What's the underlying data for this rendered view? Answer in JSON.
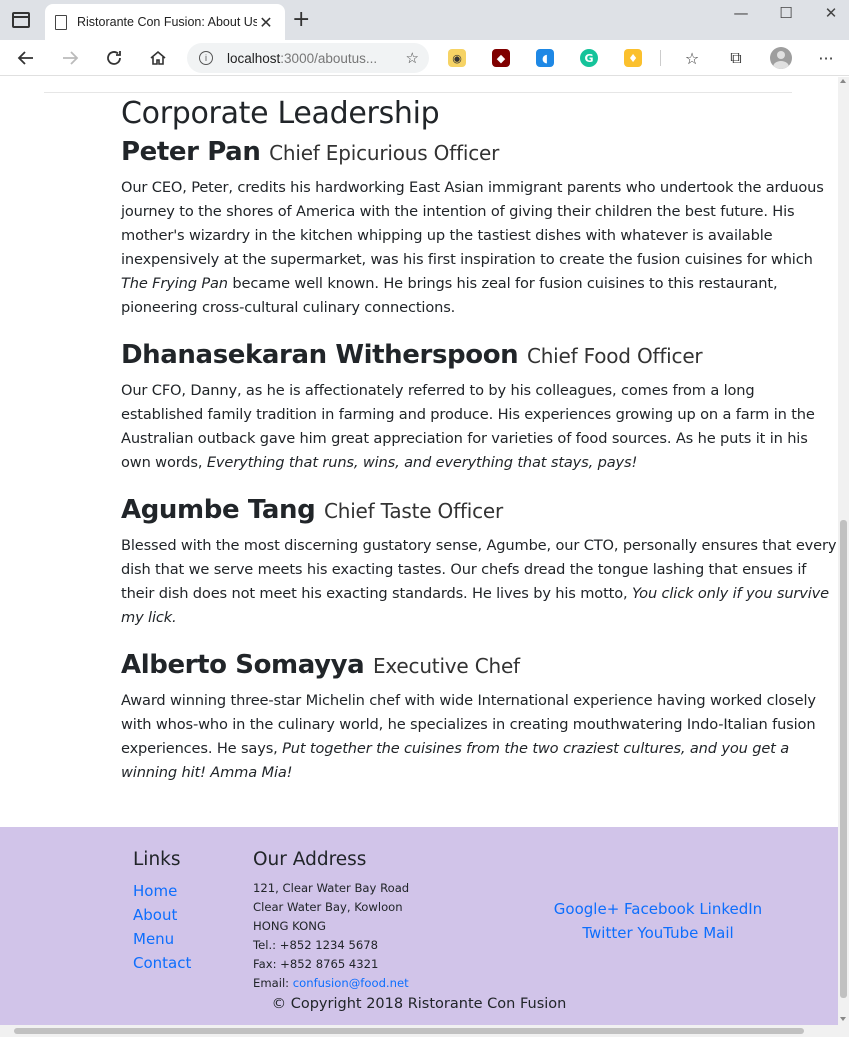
{
  "browser": {
    "tab_title": "Ristorante Con Fusion: About Us",
    "url_host": "localhost",
    "url_path": ":3000/aboutus...",
    "window_controls": {
      "minimize": "—",
      "maximize": "☐",
      "close": "✕"
    },
    "icons": [
      "tab-actions-icon",
      "page-icon",
      "close-icon",
      "new-tab-icon",
      "back-icon",
      "forward-icon",
      "refresh-icon",
      "home-icon",
      "info-icon",
      "add-favorite-icon",
      "favorites-icon",
      "collections-icon",
      "profile-icon",
      "more-icon"
    ]
  },
  "section_title": "Corporate Leadership",
  "leaders": [
    {
      "name": "Peter Pan",
      "designation": "Chief Epicurious Officer",
      "description_before": "Our CEO, Peter, credits his hardworking East Asian immigrant parents who undertook the arduous journey to the shores of America with the intention of giving their children the best future. His mother's wizardry in the kitchen whipping up the tastiest dishes with whatever is available inexpensively at the supermarket, was his first inspiration to create the fusion cuisines for which ",
      "description_em": "The Frying Pan",
      "description_after": " became well known. He brings his zeal for fusion cuisines to this restaurant, pioneering cross-cultural culinary connections."
    },
    {
      "name": "Dhanasekaran Witherspoon",
      "designation": "Chief Food Officer",
      "description_before": "Our CFO, Danny, as he is affectionately referred to by his colleagues, comes from a long established family tradition in farming and produce. His experiences growing up on a farm in the Australian outback gave him great appreciation for varieties of food sources. As he puts it in his own words, ",
      "description_em": "Everything that runs, wins, and everything that stays, pays!",
      "description_after": ""
    },
    {
      "name": "Agumbe Tang",
      "designation": "Chief Taste Officer",
      "description_before": "Blessed with the most discerning gustatory sense, Agumbe, our CTO, personally ensures that every dish that we serve meets his exacting tastes. Our chefs dread the tongue lashing that ensues if their dish does not meet his exacting standards. He lives by his motto, ",
      "description_em": "You click only if you survive my lick.",
      "description_after": ""
    },
    {
      "name": "Alberto Somayya",
      "designation": "Executive Chef",
      "description_before": "Award winning three-star Michelin chef with wide International experience having worked closely with whos-who in the culinary world, he specializes in creating mouthwatering Indo-Italian fusion experiences. He says, ",
      "description_em": "Put together the cuisines from the two craziest cultures, and you get a winning hit! Amma Mia!",
      "description_after": ""
    }
  ],
  "footer": {
    "links_title": "Links",
    "links": [
      "Home",
      "About",
      "Menu",
      "Contact"
    ],
    "address_title": "Our Address",
    "address_lines": [
      "121, Clear Water Bay Road",
      "Clear Water Bay, Kowloon",
      "HONG KONG",
      "Tel.: +852 1234 5678",
      "Fax: +852 8765 4321"
    ],
    "email_label": "Email: ",
    "email": "confusion@food.net",
    "social_row1": [
      "Google+",
      "Facebook",
      "LinkedIn"
    ],
    "social_row2": [
      "Twitter",
      "YouTube",
      "Mail"
    ],
    "copyright": "© Copyright 2018 Ristorante Con Fusion"
  }
}
